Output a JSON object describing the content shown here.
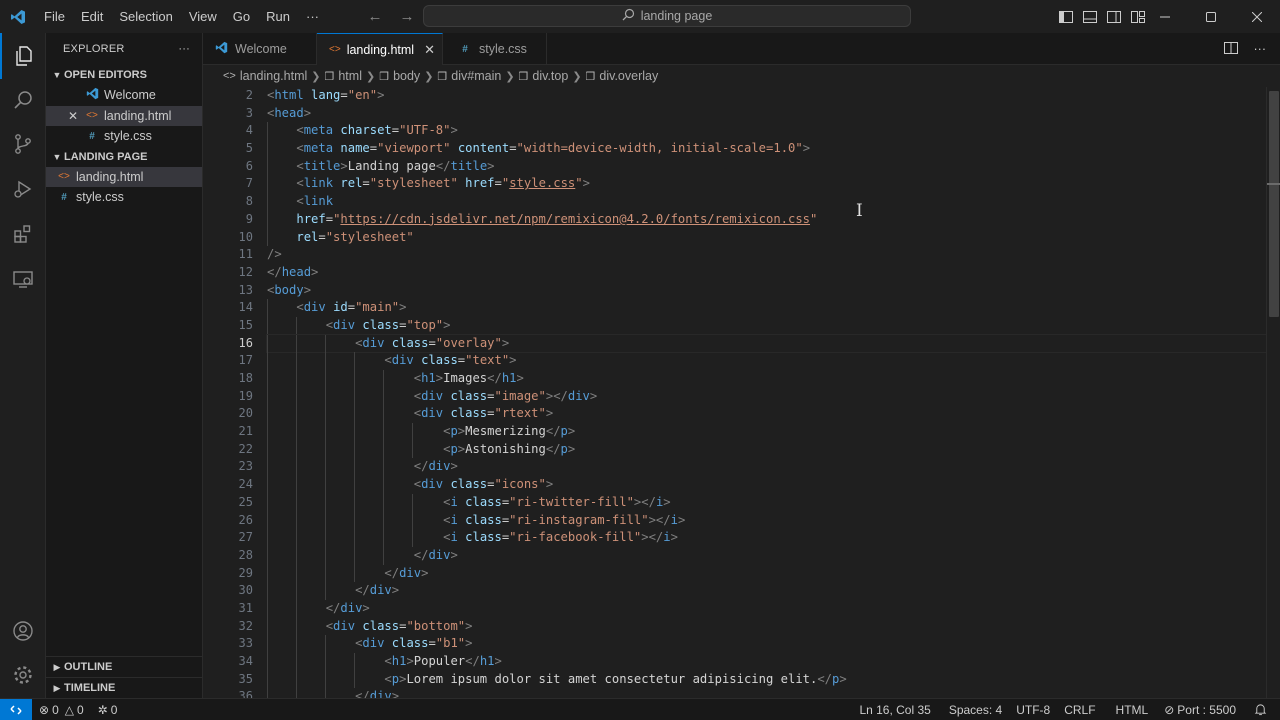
{
  "titlebar": {
    "menu": [
      "File",
      "Edit",
      "Selection",
      "View",
      "Go",
      "Run",
      "···"
    ],
    "search_text": "landing page"
  },
  "sidebar": {
    "header": "EXPLORER",
    "more": "···",
    "open_editors_title": "OPEN EDITORS",
    "open_editors": [
      {
        "label": "Welcome",
        "icon": "vscode-icon"
      },
      {
        "label": "landing.html",
        "icon": "html-icon"
      },
      {
        "label": "style.css",
        "icon": "css-icon"
      }
    ],
    "folder_title": "LANDING PAGE",
    "files": [
      {
        "label": "landing.html",
        "icon": "html-icon"
      },
      {
        "label": "style.css",
        "icon": "css-icon"
      }
    ],
    "outline": "OUTLINE",
    "timeline": "TIMELINE"
  },
  "tabs": [
    {
      "label": "Welcome",
      "icon": "vscode-icon"
    },
    {
      "label": "landing.html",
      "icon": "html-icon"
    },
    {
      "label": "style.css",
      "icon": "css-icon"
    }
  ],
  "breadcrumb": [
    "landing.html",
    "html",
    "body",
    "div#main",
    "div.top",
    "div.overlay"
  ],
  "editor": {
    "line_numbers": [
      "2",
      "3",
      "4",
      "5",
      "6",
      "7",
      "8",
      "9",
      "10",
      "11",
      "12",
      "13",
      "14",
      "15",
      "16",
      "17",
      "18",
      "19",
      "20",
      "21",
      "22",
      "23",
      "24",
      "25",
      "26",
      "27",
      "28",
      "29",
      "30",
      "31",
      "32",
      "33",
      "34",
      "35",
      "36"
    ],
    "current_line": "16"
  },
  "statusbar": {
    "errors": "0",
    "warnings": "0",
    "ports": "0",
    "position": "Ln 16, Col 35",
    "spaces": "Spaces: 4",
    "encoding": "UTF-8",
    "eol": "CRLF",
    "language": "HTML",
    "port": "Port : 5500"
  },
  "colors": {
    "accent": "#0078d4",
    "tag": "#569cd6",
    "attribute": "#9cdcfe",
    "string": "#ce9178",
    "html_icon": "#e37933",
    "css_icon": "#519aba"
  }
}
